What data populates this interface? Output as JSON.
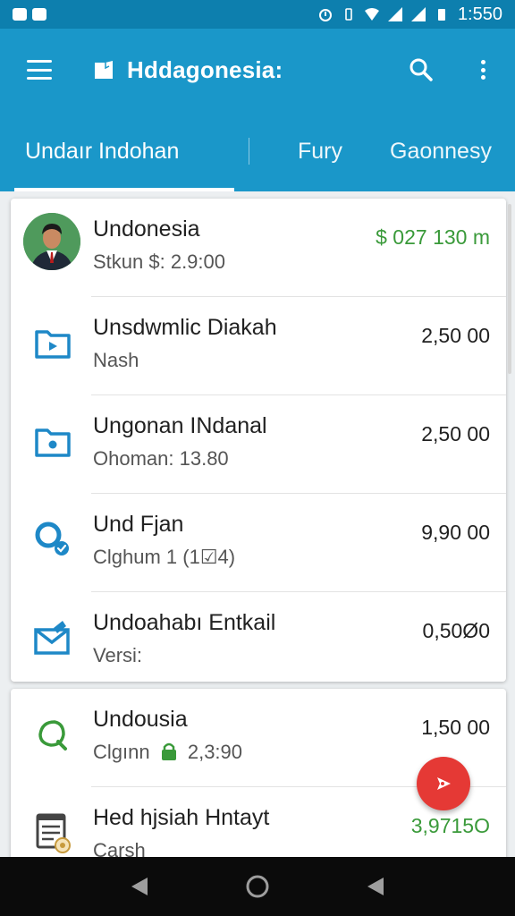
{
  "status_bar": {
    "time": "1:550"
  },
  "app_bar": {
    "title": "Hddagonesia:"
  },
  "tabs": [
    {
      "label": "Undaır Indohan"
    },
    {
      "label": "Fury"
    },
    {
      "label": "Gaonnesy"
    }
  ],
  "list_primary": [
    {
      "title": "Undonesia",
      "subtitle": "Stkun  $:  2.9:00",
      "amount": "$ 027 130 m",
      "icon": "avatar-photo",
      "amount_color": "#3a9a3a"
    },
    {
      "title": "Unsdwmlic Diakah",
      "subtitle": "Nash",
      "amount": "2,50 00",
      "icon": "folder-play-icon"
    },
    {
      "title": "Ungonan INdanal",
      "subtitle": "Ohoman:  13.80",
      "amount": "2,50 00",
      "icon": "folder-dot-icon"
    },
    {
      "title": "Und Fjan",
      "subtitle": "Clghum  1 (1☑4)",
      "amount": "9,90 00",
      "icon": "search-check-icon"
    },
    {
      "title": "Undoahabı Entkail",
      "subtitle": "Versi:",
      "amount": "0,50Ø0",
      "icon": "mail-icon"
    }
  ],
  "list_secondary": [
    {
      "title": "Undousia",
      "subtitle_prefix": "Clgınn",
      "subtitle_value": "2,3:90",
      "amount": "1,50 00",
      "icon": "leaf-search-icon"
    },
    {
      "title": "Hed hjsiah Hntayt",
      "subtitle": "Carsh",
      "amount": "3,9715O",
      "icon": "document-icon",
      "amount_color": "#3a9a3a"
    }
  ],
  "colors": {
    "app_bar": "#1a97c9",
    "status_bar": "#0d7fae",
    "accent_blue": "#1e88c7",
    "accent_green": "#3a9a3a",
    "fab": "#e53935"
  }
}
